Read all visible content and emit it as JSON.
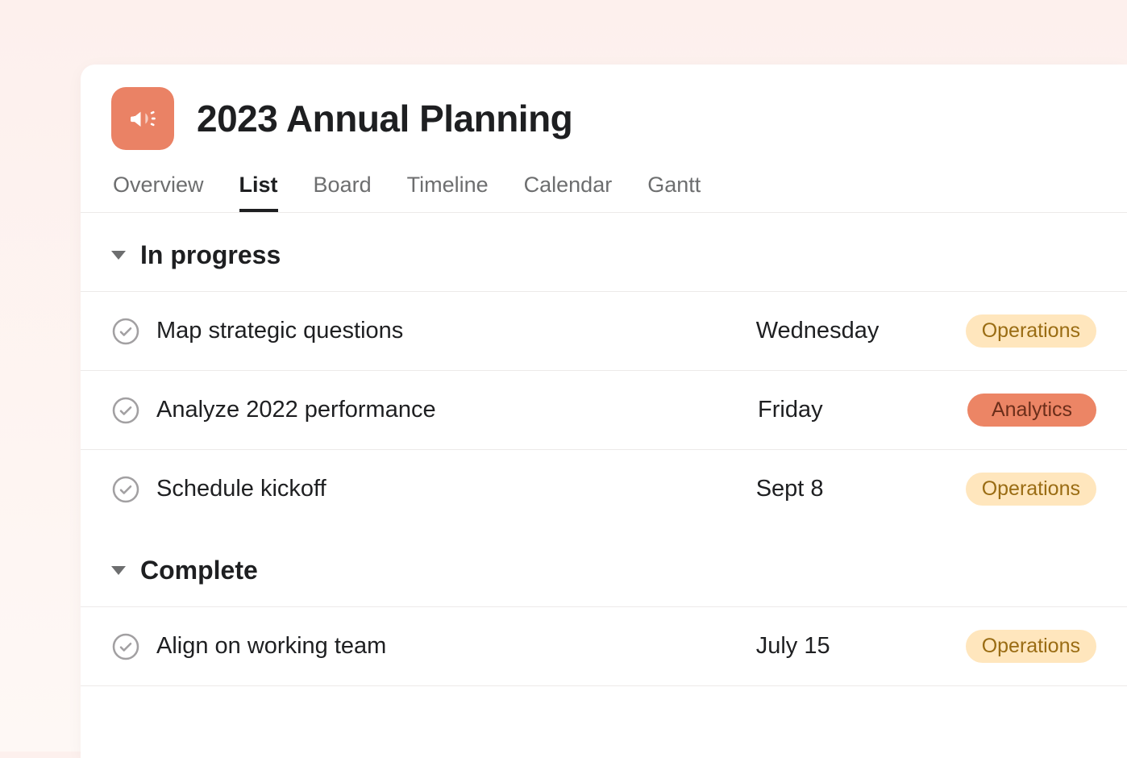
{
  "project": {
    "title": "2023 Annual Planning",
    "icon": "megaphone-icon"
  },
  "tabs": [
    {
      "label": "Overview",
      "active": false
    },
    {
      "label": "List",
      "active": true
    },
    {
      "label": "Board",
      "active": false
    },
    {
      "label": "Timeline",
      "active": false
    },
    {
      "label": "Calendar",
      "active": false
    },
    {
      "label": "Gantt",
      "active": false
    }
  ],
  "sections": [
    {
      "name": "In progress",
      "tasks": [
        {
          "title": "Map strategic questions",
          "date": "Wednesday",
          "tag": "Operations",
          "tagClass": "tag-operations"
        },
        {
          "title": "Analyze 2022 performance",
          "date": "Friday",
          "tag": "Analytics",
          "tagClass": "tag-analytics"
        },
        {
          "title": "Schedule kickoff",
          "date": "Sept 8",
          "tag": "Operations",
          "tagClass": "tag-operations"
        }
      ]
    },
    {
      "name": "Complete",
      "tasks": [
        {
          "title": "Align on working team",
          "date": "July 15",
          "tag": "Operations",
          "tagClass": "tag-operations"
        }
      ]
    }
  ]
}
